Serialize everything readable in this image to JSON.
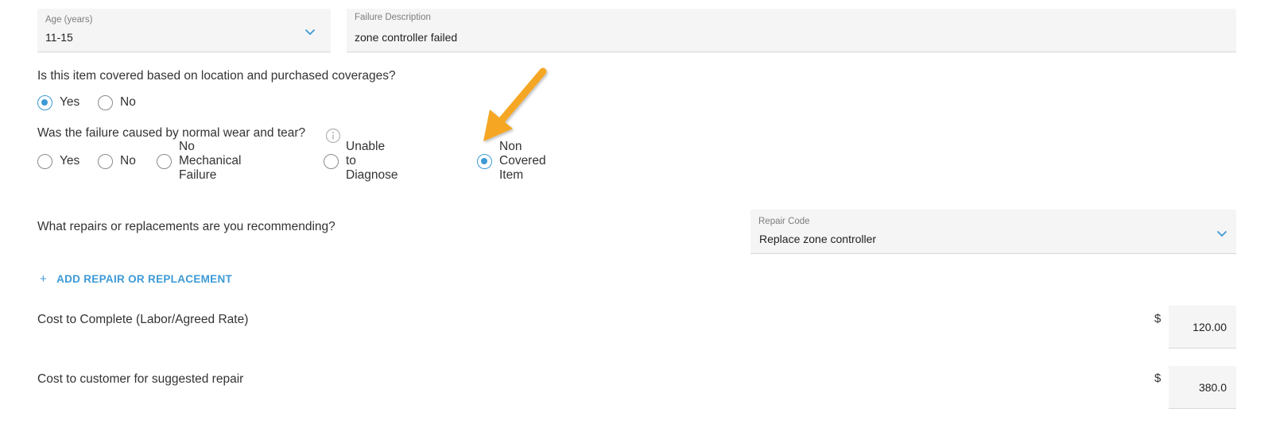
{
  "age": {
    "label": "Age (years)",
    "value": "11-15",
    "icon": "chevron-down-icon"
  },
  "failure_description": {
    "label": "Failure Description",
    "value": "zone controller failed"
  },
  "coverage_question": {
    "text": "Is this item covered based on location and purchased coverages?",
    "options": [
      {
        "label": "Yes",
        "checked": true
      },
      {
        "label": "No",
        "checked": false
      }
    ]
  },
  "wear_question": {
    "text": "Was the failure caused by normal wear and tear?",
    "info_icon": "info-icon",
    "options": [
      {
        "label": "Yes",
        "checked": false
      },
      {
        "label": "No",
        "checked": false
      },
      {
        "label": "No Mechanical Failure",
        "checked": false
      },
      {
        "label": "Unable to Diagnose",
        "checked": false
      },
      {
        "label": "Non Covered Item",
        "checked": true
      }
    ]
  },
  "repairs": {
    "question": "What repairs or replacements are you recommending?",
    "repair_code_label": "Repair Code",
    "repair_code_value": "Replace zone controller",
    "icon": "chevron-down-icon"
  },
  "add_repair": {
    "icon": "plus-icon",
    "label": "ADD REPAIR OR REPLACEMENT"
  },
  "cost_complete": {
    "label": "Cost to Complete (Labor/Agreed Rate)",
    "currency": "$",
    "value": "120.00"
  },
  "cost_customer": {
    "label": "Cost to customer for suggested repair",
    "currency": "$",
    "value": "380.0"
  },
  "colors": {
    "accent": "#3d9ad6",
    "annotation_arrow": "#f5a623",
    "field_bg": "#f5f5f5"
  }
}
